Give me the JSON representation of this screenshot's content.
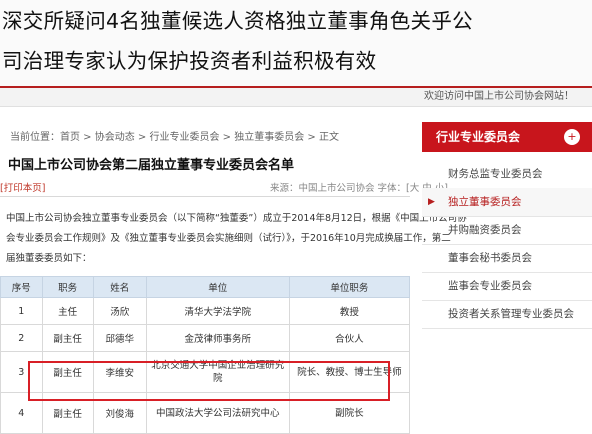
{
  "headline": {
    "line1": "深交所疑问4名独董候选人资格独立董事角色关乎公",
    "line2": "司治理专家认为保护投资者利益积极有效"
  },
  "site": {
    "home_label": "首页",
    "notice": "欢迎访问中国上市公司协会网站！"
  },
  "article": {
    "breadcrumb": "当前位置：首页 > 协会动态 > 行业专业委员会 > 独立董事委员会 > 正文",
    "title": "中国上市公司协会第二届独立董事专业委员会名单",
    "print": "[打印本页]",
    "meta": "来源：中国上市公司协会  字体：[大 中 小]",
    "paragraphs": [
      "中国上市公司协会独立董事专业委员会（以下简称“独董委”）成立于2014年8月12日，根据《中国上市公司协",
      "会专业委员会工作规则》及《独立董事专业委员会实施细则（试行）》，于2016年10月完成换届工作，第二",
      "届独董委委员如下："
    ]
  },
  "table": {
    "headers": [
      "序号",
      "职务",
      "姓名",
      "单位",
      "单位职务"
    ],
    "rows": [
      {
        "no": "1",
        "role": "主任",
        "name": "汤欣",
        "unit": "清华大学法学院",
        "title": "教授"
      },
      {
        "no": "2",
        "role": "副主任",
        "name": "邱德华",
        "unit": "金茂律师事务所",
        "title": "合伙人"
      },
      {
        "no": "3",
        "role": "副主任",
        "name": "李维安",
        "unit": "北京交通大学中国企业治理研究院",
        "title": "院长、教授、博士生导师"
      },
      {
        "no": "4",
        "role": "副主任",
        "name": "刘俊海",
        "unit": "中国政法大学公司法研究中心",
        "title": "副院长"
      }
    ]
  },
  "sidebar": {
    "title": "行业专业委员会",
    "items": [
      "财务总监专业委员会",
      "独立董事委员会",
      "并购融资委员会",
      "董事会秘书委员会",
      "监事会专业委员会",
      "投资者关系管理专业委员会"
    ],
    "active_index": 1
  },
  "colors": {
    "brand_red": "#b61e1e",
    "highlight": "#d81f26",
    "table_header": "#dbe7f3"
  }
}
